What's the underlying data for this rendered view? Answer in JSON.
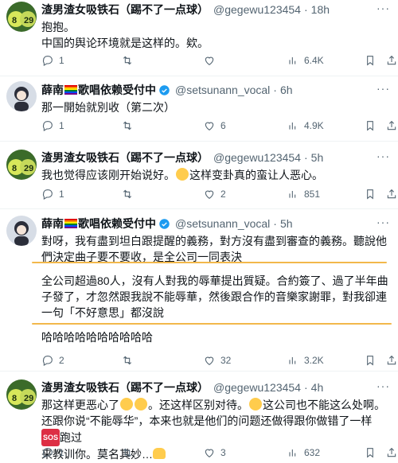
{
  "tweets": [
    {
      "name": "渣男渣女吸铁石（踢不了一点球）",
      "handle": "@gegewu123454",
      "time": "18h",
      "text": "抱抱。\n中国的舆论环境就是这样的。欸。",
      "replies": "1",
      "retweets": "",
      "likes": "",
      "views": "6.4K"
    },
    {
      "name_a": "薛南",
      "name_b": "歌唱依赖受付中",
      "handle": "@setsunann_vocal",
      "time": "6h",
      "text": "那一開始就別收（第二次）",
      "replies": "1",
      "retweets": "",
      "likes": "6",
      "views": "4.9K"
    },
    {
      "name": "渣男渣女吸铁石（踢不了一点球）",
      "handle": "@gegewu123454",
      "time": "5h",
      "text_a": "我也觉得应该刚开始说好。",
      "text_b": "这样变卦真的蛮让人恶心。",
      "replies": "1",
      "retweets": "",
      "likes": "2",
      "views": "851"
    },
    {
      "name_a": "薛南",
      "name_b": "歌唱依赖受付中",
      "handle": "@setsunann_vocal",
      "time": "5h",
      "para1": "對呀，我有盡到坦白跟提醒的義務，對方沒有盡到審查的義務。聽說他們決定曲子要不要收，是全公司一同表決",
      "para2": "全公司超過80人，沒有人對我的辱華提出質疑。合約簽了、過了半年曲子發了，才忽然跟我說不能辱華，然後跟合作的音樂家謝罪，對我卻連一句「不好意思」都沒說",
      "para3": "哈哈哈哈哈哈哈哈哈哈",
      "replies": "2",
      "retweets": "",
      "likes": "32",
      "views": "3.2K"
    },
    {
      "name": "渣男渣女吸铁石（踢不了一点球）",
      "handle": "@gegewu123454",
      "time": "4h",
      "line1_a": "那这样更恶心了",
      "line1_b": "。还这样区别对待。",
      "line1_c": "这公司也不能这么处啊。",
      "line2_a": "还跟你说“不能辱华”，本来也就是他们的问题还做得跟你做错了一样",
      "sos": "SOS",
      "line2_b": "跑过",
      "line3": "来教训你。莫名其妙…",
      "replies": "1",
      "retweets": "",
      "likes": "3",
      "views": "632"
    }
  ],
  "more_label": "···",
  "colors": {
    "accent": "#1d9bf0",
    "muted": "#536471",
    "highlight": "#f2b84b"
  }
}
